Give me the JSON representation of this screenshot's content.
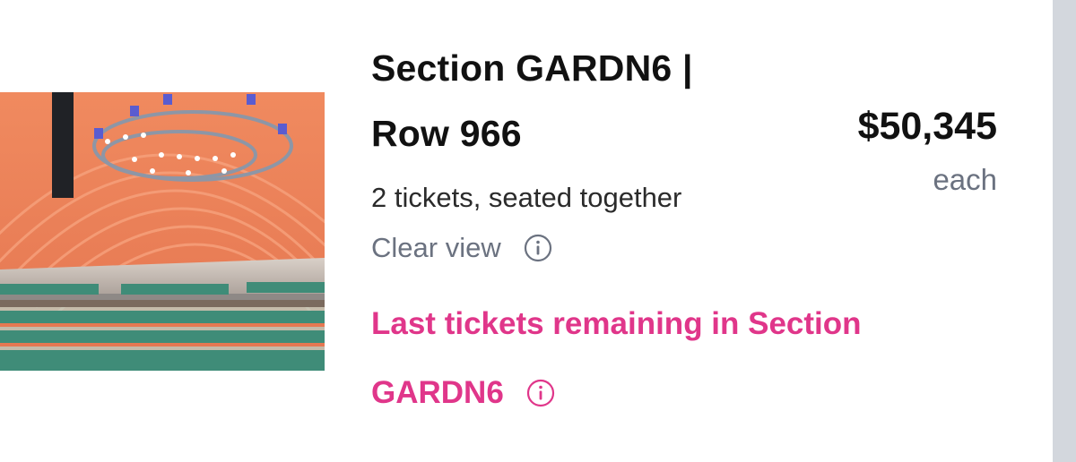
{
  "listing": {
    "thumbnail_alt": "venue-view-image",
    "title_line1": "Section GARDN6 |",
    "title_line2": "Row 966",
    "tickets_text": "2 tickets, seated together",
    "view_text": "Clear view",
    "price": "$50,345",
    "price_unit": "each",
    "urgency_line1": "Last tickets remaining in Section",
    "urgency_line2": "GARDN6"
  },
  "colors": {
    "accent": "#e0368a",
    "muted": "#6b7280",
    "text": "#111111",
    "scrollbar": "#d3d7dd"
  },
  "icons": {
    "view_info": "info-circle-icon",
    "urgency_info": "info-circle-icon"
  }
}
